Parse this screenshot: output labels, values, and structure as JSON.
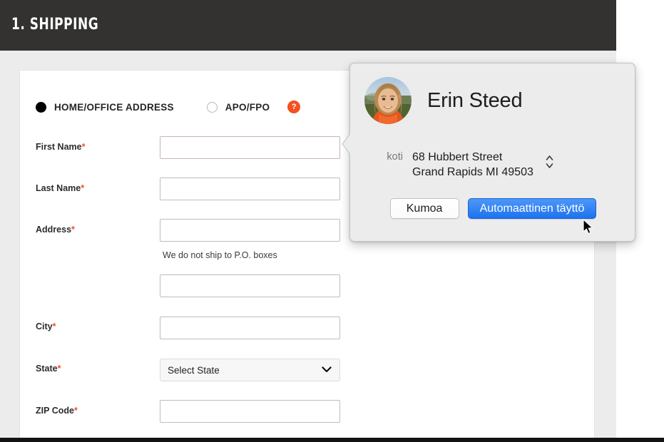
{
  "page": {
    "section_header": {
      "title": "1. SHIPPING"
    },
    "colors": {
      "header_bg": "#333231",
      "page_bg": "#ececec",
      "accent_orange": "#f4511e",
      "primary_blue": "#1d73ef"
    },
    "address_type": {
      "options": [
        {
          "label": "HOME/OFFICE ADDRESS",
          "selected": true
        },
        {
          "label": "APO/FPO",
          "selected": false
        }
      ],
      "help_icon": "help-question-icon",
      "help_glyph": "?"
    },
    "fields": [
      {
        "label": "First Name",
        "required_marker": "*",
        "value": "",
        "placeholder": "",
        "type": "text"
      },
      {
        "label": "Last Name",
        "required_marker": "*",
        "value": "",
        "placeholder": "",
        "type": "text"
      },
      {
        "label": "Address",
        "required_marker": "*",
        "value": "",
        "placeholder": "",
        "type": "text"
      },
      {
        "label": "",
        "required_marker": "",
        "value": "",
        "placeholder": "",
        "type": "text"
      },
      {
        "label": "City",
        "required_marker": "*",
        "value": "",
        "placeholder": "",
        "type": "text"
      },
      {
        "label": "State",
        "required_marker": "*",
        "value": "Select State",
        "placeholder": "",
        "type": "select"
      },
      {
        "label": "ZIP Code",
        "required_marker": "*",
        "value": "",
        "placeholder": "",
        "type": "text"
      }
    ],
    "helper_text": "We do not ship to P.O. boxes"
  },
  "popover": {
    "contact_name": "Erin Steed",
    "avatar_icon": "user-photo-avatar",
    "address_label": "koti",
    "address_line1": "68 Hubbert Street",
    "address_line2": "Grand Rapids MI 49503",
    "stepper_icon": "up-down-stepper-icon",
    "buttons": {
      "cancel": "Kumoa",
      "autofill": "Automaattinen täyttö"
    }
  },
  "cursor": {
    "icon": "mouse-pointer-icon"
  }
}
